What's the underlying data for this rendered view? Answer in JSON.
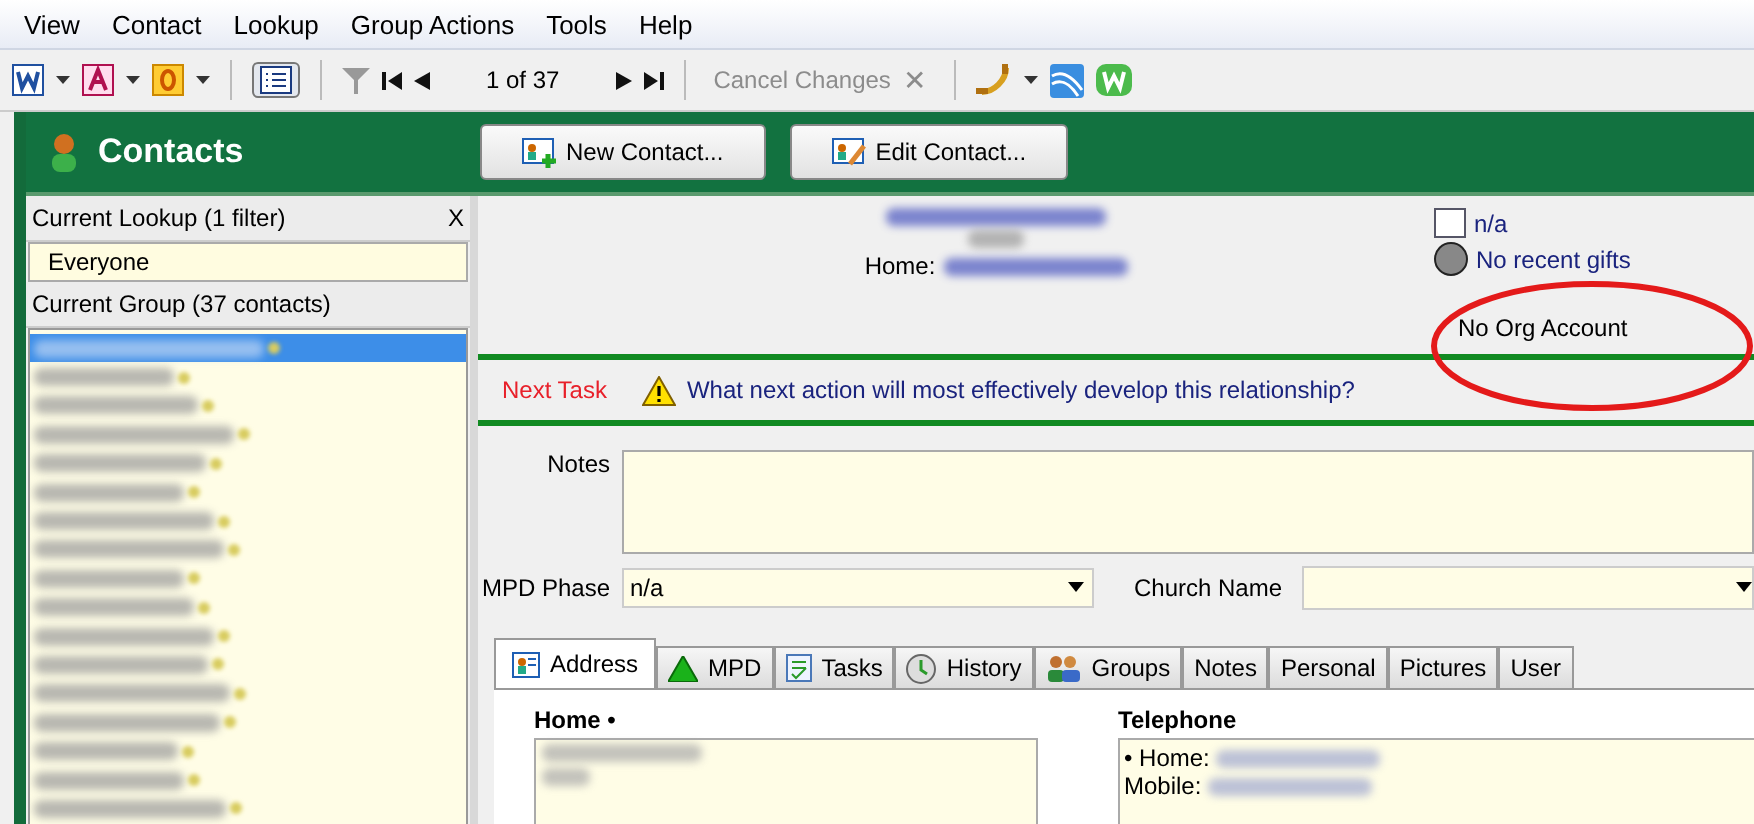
{
  "menu": [
    "View",
    "Contact",
    "Lookup",
    "Group Actions",
    "Tools",
    "Help"
  ],
  "toolbar": {
    "list_view_pressed": true,
    "record_position": "1 of 37",
    "cancel": {
      "label": "Cancel Changes",
      "close": "✕",
      "disabled": true
    }
  },
  "header": {
    "title": "Contacts",
    "buttons": [
      {
        "label": "New Contact...",
        "kind": "new"
      },
      {
        "label": "Edit Contact...",
        "kind": "edit"
      }
    ]
  },
  "sidebar": {
    "lookup_title": "Current Lookup (1 filter)",
    "lookup_close": "X",
    "lookup_value": "Everyone",
    "group_title": "Current Group (37 contacts)",
    "contacts": [
      {
        "selected": true
      },
      {
        "selected": false
      },
      {
        "selected": false
      },
      {
        "selected": false
      },
      {
        "selected": false
      },
      {
        "selected": false
      },
      {
        "selected": false
      },
      {
        "selected": false
      },
      {
        "selected": false
      },
      {
        "selected": false
      },
      {
        "selected": false
      },
      {
        "selected": false
      },
      {
        "selected": false
      },
      {
        "selected": false
      },
      {
        "selected": false
      },
      {
        "selected": false
      },
      {
        "selected": false
      }
    ]
  },
  "summary": {
    "home_label": "Home:",
    "status_checkbox": {
      "label": "n/a",
      "checked": false
    },
    "gift_status": "No recent gifts",
    "org_account": "No Org Account"
  },
  "next_task": {
    "label": "Next Task",
    "prompt": "What next action will most effectively develop this relationship?"
  },
  "notes": {
    "label": "Notes"
  },
  "mpd_phase": {
    "label": "MPD Phase",
    "value": "n/a"
  },
  "church_name": {
    "label": "Church Name"
  },
  "tabs": [
    {
      "label": "Address",
      "selected": true
    },
    {
      "label": "MPD",
      "selected": false
    },
    {
      "label": "Tasks",
      "selected": false
    },
    {
      "label": "History",
      "selected": false
    },
    {
      "label": "Groups",
      "selected": false
    },
    {
      "label": "Notes",
      "selected": false
    },
    {
      "label": "Personal",
      "selected": false
    },
    {
      "label": "Pictures",
      "selected": false
    },
    {
      "label": "User",
      "selected": false
    }
  ],
  "address": {
    "home_label": "Home •",
    "telephone_label": "Telephone",
    "phones": [
      {
        "label": "• Home:"
      },
      {
        "label": "Mobile:"
      }
    ]
  }
}
